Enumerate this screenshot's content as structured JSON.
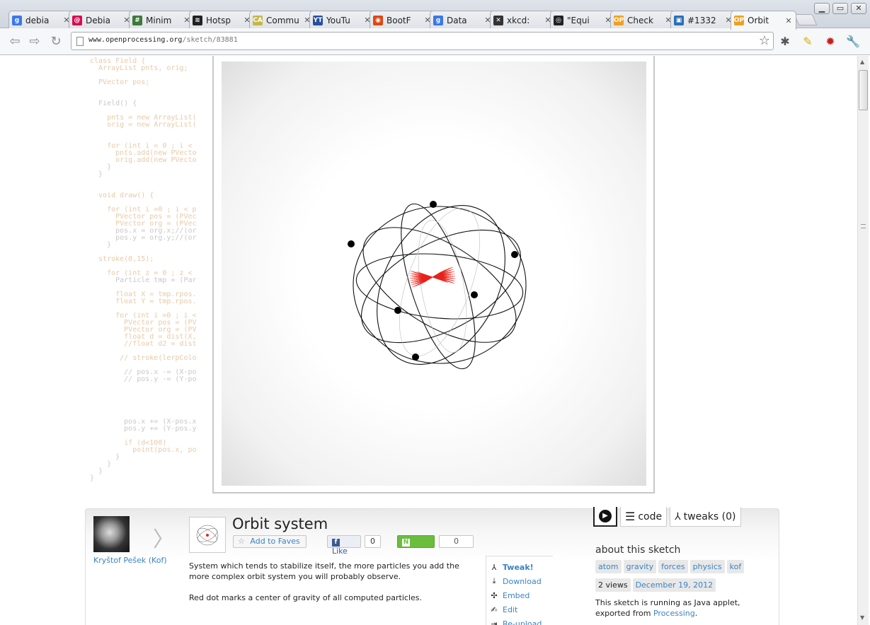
{
  "window": {
    "tabs": [
      {
        "title": "debia",
        "icon": "google-icon",
        "color": "#3b78e7",
        "glyph": "g"
      },
      {
        "title": "Debia",
        "icon": "debian-icon",
        "color": "#d70a53",
        "glyph": "@"
      },
      {
        "title": "Minim",
        "icon": "minim-icon",
        "color": "#3c7a3c",
        "glyph": "#"
      },
      {
        "title": "Hotsp",
        "icon": "wifi-icon",
        "color": "#222222",
        "glyph": "≋"
      },
      {
        "title": "Commu",
        "icon": "ca-icon",
        "color": "#c4b74a",
        "glyph": "CA"
      },
      {
        "title": "YouTu",
        "icon": "youtube-mp3-icon",
        "color": "#2a4f9e",
        "glyph": "YT"
      },
      {
        "title": "BootF",
        "icon": "ubuntu-icon",
        "color": "#dd4814",
        "glyph": "◉"
      },
      {
        "title": "Data",
        "icon": "google-icon",
        "color": "#3b78e7",
        "glyph": "g"
      },
      {
        "title": "xkcd:",
        "icon": "xkcd-icon",
        "color": "#333333",
        "glyph": "✕"
      },
      {
        "title": "\"Equi",
        "icon": "github-icon",
        "color": "#222222",
        "glyph": "◎"
      },
      {
        "title": "Check",
        "icon": "openprocessing-icon",
        "color": "#f0a020",
        "glyph": "OP"
      },
      {
        "title": "#1332",
        "icon": "tracker-icon",
        "color": "#2a6fb6",
        "glyph": "▣"
      },
      {
        "title": "Orbit",
        "icon": "openprocessing-icon",
        "color": "#f0a020",
        "glyph": "OP"
      }
    ],
    "active_tab_index": 12,
    "controls": {
      "minimize": "▁",
      "maximize": "▭",
      "close": "✕"
    }
  },
  "toolbar": {
    "url_host": "www.openprocessing.org",
    "url_path": "/sketch/83881",
    "back_glyph": "⇦",
    "forward_glyph": "⇨",
    "reload_glyph": "↻",
    "star_glyph": "☆",
    "extensions": [
      {
        "name": "bug-extension-icon",
        "glyph": "✱",
        "color": "#555555"
      },
      {
        "name": "highlighter-extension-icon",
        "glyph": "✎",
        "color": "#d4b000"
      },
      {
        "name": "adblock-extension-icon",
        "glyph": "✹",
        "color": "#c0221b"
      },
      {
        "name": "wrench-menu-icon",
        "glyph": "🔧",
        "color": "#555555"
      }
    ]
  },
  "code_lines": [
    "class Field {",
    "  ArrayList pnts, orig;",
    "",
    "  PVector pos;",
    "",
    "",
    "  Field() {",
    "",
    "    pnts = new ArrayList(",
    "    orig = new ArrayList(",
    "",
    "",
    "    for (int i = 0 ; i <",
    "      pnts.add(new PVecto",
    "      orig.add(new PVecto",
    "    }",
    "  }",
    "",
    "",
    "  void draw() {",
    "",
    "    for (int i =0 ; i < p",
    "      PVector pos = (PVec",
    "      PVector org = (PVec",
    "      pos.x = org.x;//(or",
    "      pos.y = org.y;//(or",
    "    }",
    "",
    "  stroke(0,15);",
    "",
    "    for (int z = 0 ; z <",
    "      Particle tmp = (Par",
    "",
    "      float X = tmp.rpos.",
    "      float Y = tmp.rpos.",
    "",
    "      for (int i =0 ; i <",
    "        PVector pos = (PV",
    "        PVector org = (PV",
    "        float d = dist(X,",
    "        //float d2 = dist",
    "",
    "       // stroke(lerpColo",
    "",
    "        // pos.x -= (X-po",
    "        // pos.y -= (Y-po",
    "",
    "",
    "",
    "",
    "",
    "        pos.x += (X-pos.x",
    "        pos.y += (Y-pos.y",
    "",
    "        if (d<100)",
    "          point(pos.x, po",
    "      }",
    "    }",
    "  }",
    "}"
  ],
  "sketch": {
    "author": "Kryštof Pešek (Kof)",
    "title": "Orbit system",
    "add_to_faves": "Add to Faves",
    "like_label": "Like",
    "like_count": "0",
    "flattr_label": "Flattr",
    "flattr_count": "0",
    "description_1": "System which tends to stabilize itself, the more particles you add the more complex orbit system you will probably observe.",
    "description_2": "Red dot marks a center of gravity of all computed particles.",
    "actions": [
      {
        "label": "Tweak!",
        "icon": "tweak-icon",
        "glyph": "⅄"
      },
      {
        "label": "Download",
        "icon": "download-icon",
        "glyph": "⤓"
      },
      {
        "label": "Embed",
        "icon": "puzzle-icon",
        "glyph": "✣"
      },
      {
        "label": "Edit",
        "icon": "edit-icon",
        "glyph": "✍"
      },
      {
        "label": "Re-upload",
        "icon": "upload-icon",
        "glyph": "⇥"
      }
    ],
    "view_tabs": [
      {
        "label": "",
        "icon": "play-icon"
      },
      {
        "label": "code",
        "icon": "code-lines-icon"
      },
      {
        "label": "tweaks (0)",
        "icon": "tweak-icon"
      }
    ],
    "about_heading": "about this sketch",
    "tags": [
      "atom",
      "gravity",
      "forces",
      "physics",
      "kof"
    ],
    "views": "2 views",
    "date": "December 19, 2012",
    "run_info": "This sketch is running as Java applet, exported from",
    "run_link": "Processing",
    "run_suffix": "."
  },
  "colors": {
    "link": "#3a83c4",
    "flattr": "#6bbd3e",
    "center_of_gravity": "#e8231b"
  }
}
